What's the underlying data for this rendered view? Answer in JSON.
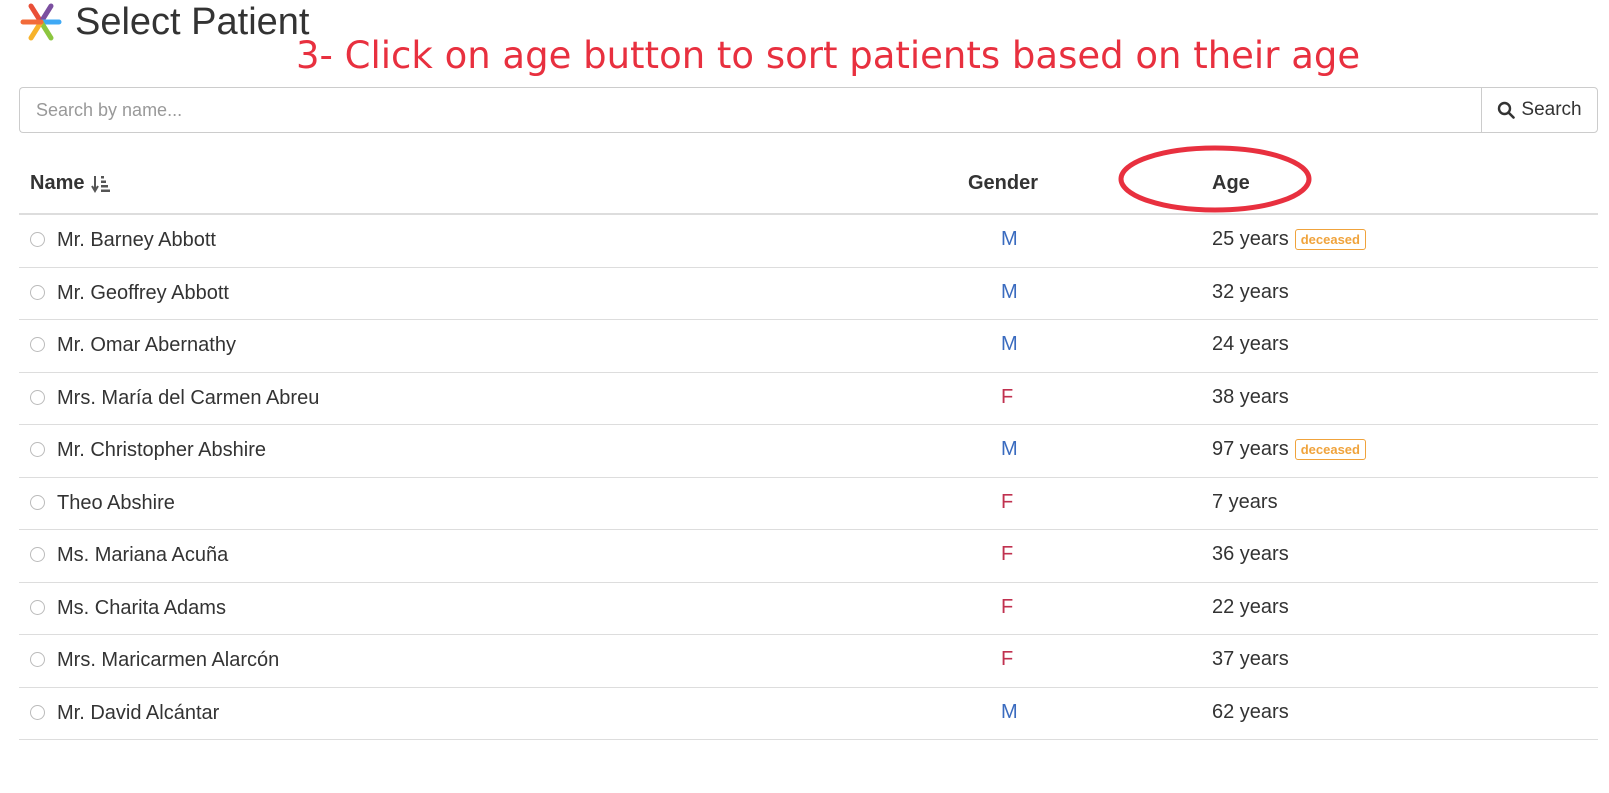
{
  "header": {
    "title": "Select Patient",
    "logo_icon": "star-logo-icon"
  },
  "annotation": {
    "text": "3- Click on age button to sort patients based on their age",
    "color": "#e8303f"
  },
  "search": {
    "placeholder": "Search by name...",
    "button_label": "Search"
  },
  "table": {
    "columns": {
      "name": "Name",
      "gender": "Gender",
      "age": "Age"
    },
    "rows": [
      {
        "name": "Mr. Barney Abbott",
        "gender": "M",
        "age": "25 years",
        "badge": "deceased"
      },
      {
        "name": "Mr. Geoffrey Abbott",
        "gender": "M",
        "age": "32 years",
        "badge": ""
      },
      {
        "name": "Mr. Omar Abernathy",
        "gender": "M",
        "age": "24 years",
        "badge": ""
      },
      {
        "name": "Mrs. María del Carmen Abreu",
        "gender": "F",
        "age": "38 years",
        "badge": ""
      },
      {
        "name": "Mr. Christopher Abshire",
        "gender": "M",
        "age": "97 years",
        "badge": "deceased"
      },
      {
        "name": "Theo Abshire",
        "gender": "F",
        "age": "7 years",
        "badge": ""
      },
      {
        "name": "Ms. Mariana Acuña",
        "gender": "F",
        "age": "36 years",
        "badge": ""
      },
      {
        "name": "Ms. Charita Adams",
        "gender": "F",
        "age": "22 years",
        "badge": ""
      },
      {
        "name": "Mrs. Maricarmen Alarcón",
        "gender": "F",
        "age": "37 years",
        "badge": ""
      },
      {
        "name": "Mr. David Alcántar",
        "gender": "M",
        "age": "62 years",
        "badge": ""
      }
    ]
  },
  "colors": {
    "male": "#3a6bbf",
    "female": "#c0314f",
    "badge": "#f0a33c",
    "annotation": "#e8303f"
  }
}
